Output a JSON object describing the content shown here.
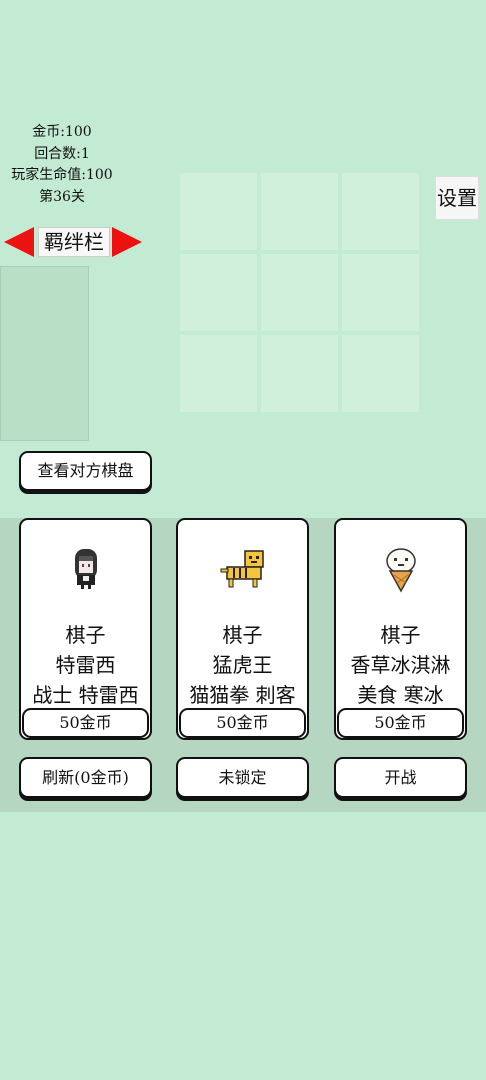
{
  "stats": {
    "gold": "金币:100",
    "round": "回合数:1",
    "player_hp": "玩家生命值:100",
    "level": "第36关"
  },
  "bond": {
    "title": "羁绊栏"
  },
  "settings_label": "设置",
  "view_opponent_label": "查看对方棋盘",
  "shop": {
    "cards": [
      {
        "sprite": "hooded-girl-icon",
        "type": "棋子",
        "name": "特雷西",
        "tags": "战士 特雷西",
        "price": "50金币"
      },
      {
        "sprite": "tiger-icon",
        "type": "棋子",
        "name": "猛虎王",
        "tags": "猫猫拳 刺客",
        "price": "50金币"
      },
      {
        "sprite": "ice-cream-icon",
        "type": "棋子",
        "name": "香草冰淇淋",
        "tags": "美食 寒冰",
        "price": "50金币"
      }
    ],
    "refresh_label": "刷新(0金币)",
    "lock_label": "未锁定",
    "battle_label": "开战"
  },
  "colors": {
    "background": "#c3ebd3",
    "board_cell": "#d0f0dc",
    "arrow": "#ee1111",
    "shop_panel": "#b5d7c2"
  }
}
